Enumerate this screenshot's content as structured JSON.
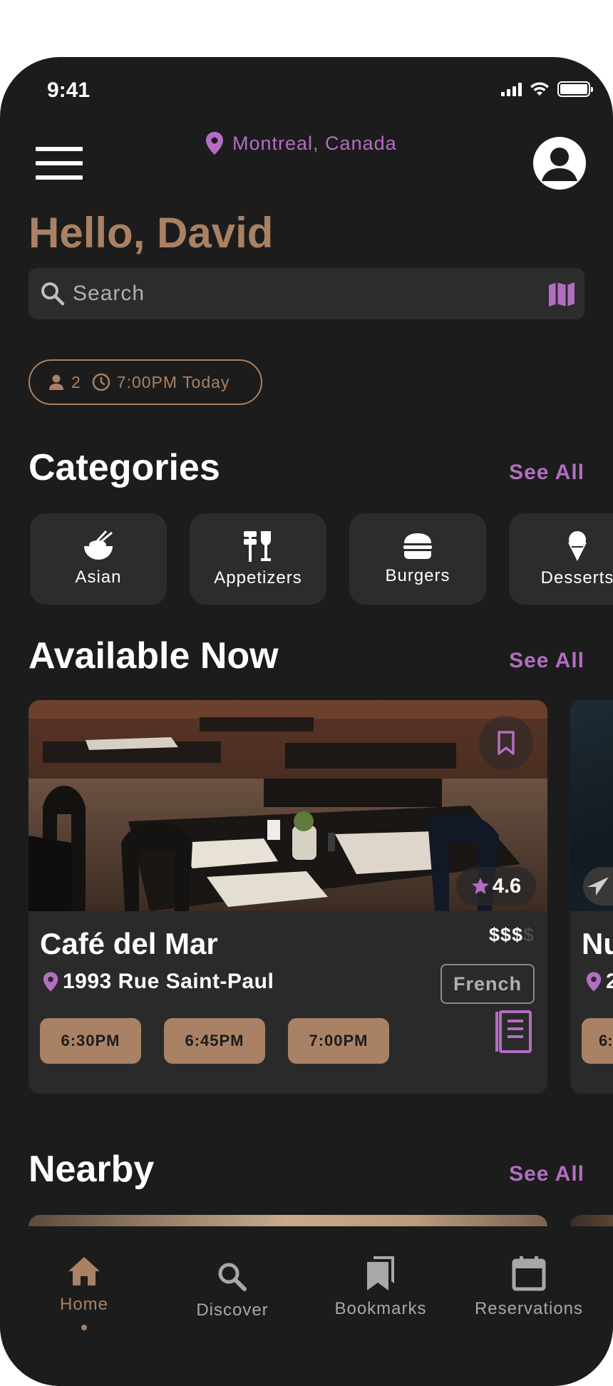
{
  "status_bar": {
    "time": "9:41"
  },
  "header": {
    "location": "Montreal, Canada"
  },
  "greeting": "Hello, David",
  "search": {
    "placeholder": "Search"
  },
  "party": {
    "guests": "2",
    "time": "7:00PM Today"
  },
  "categories": {
    "title": "Categories",
    "see_all": "See All",
    "items": [
      {
        "label": "Asian",
        "icon": "rice-bowl-icon"
      },
      {
        "label": "Appetizers",
        "icon": "appetizers-icon"
      },
      {
        "label": "Burgers",
        "icon": "burger-icon"
      },
      {
        "label": "Desserts",
        "icon": "ice-cream-icon"
      }
    ]
  },
  "available_now": {
    "title": "Available Now",
    "see_all": "See All",
    "restaurants": [
      {
        "name": "Café del Mar",
        "price": "$$$",
        "price_dim": "$",
        "address": "1993 Rue Saint-Paul",
        "cuisine": "French",
        "rating": "4.6",
        "slots": [
          "6:30PM",
          "6:45PM",
          "7:00PM"
        ]
      },
      {
        "name": "Nu",
        "address": "2",
        "slot": "6:"
      }
    ]
  },
  "nearby": {
    "title": "Nearby",
    "see_all": "See All"
  },
  "tabbar": {
    "items": [
      {
        "label": "Home",
        "active": true
      },
      {
        "label": "Discover",
        "active": false
      },
      {
        "label": "Bookmarks",
        "active": false
      },
      {
        "label": "Reservations",
        "active": false
      }
    ]
  },
  "colors": {
    "background": "#1c1c1c",
    "surface": "#2c2c2c",
    "accent_brown": "#a98164",
    "accent_purple": "#b36ec2"
  }
}
